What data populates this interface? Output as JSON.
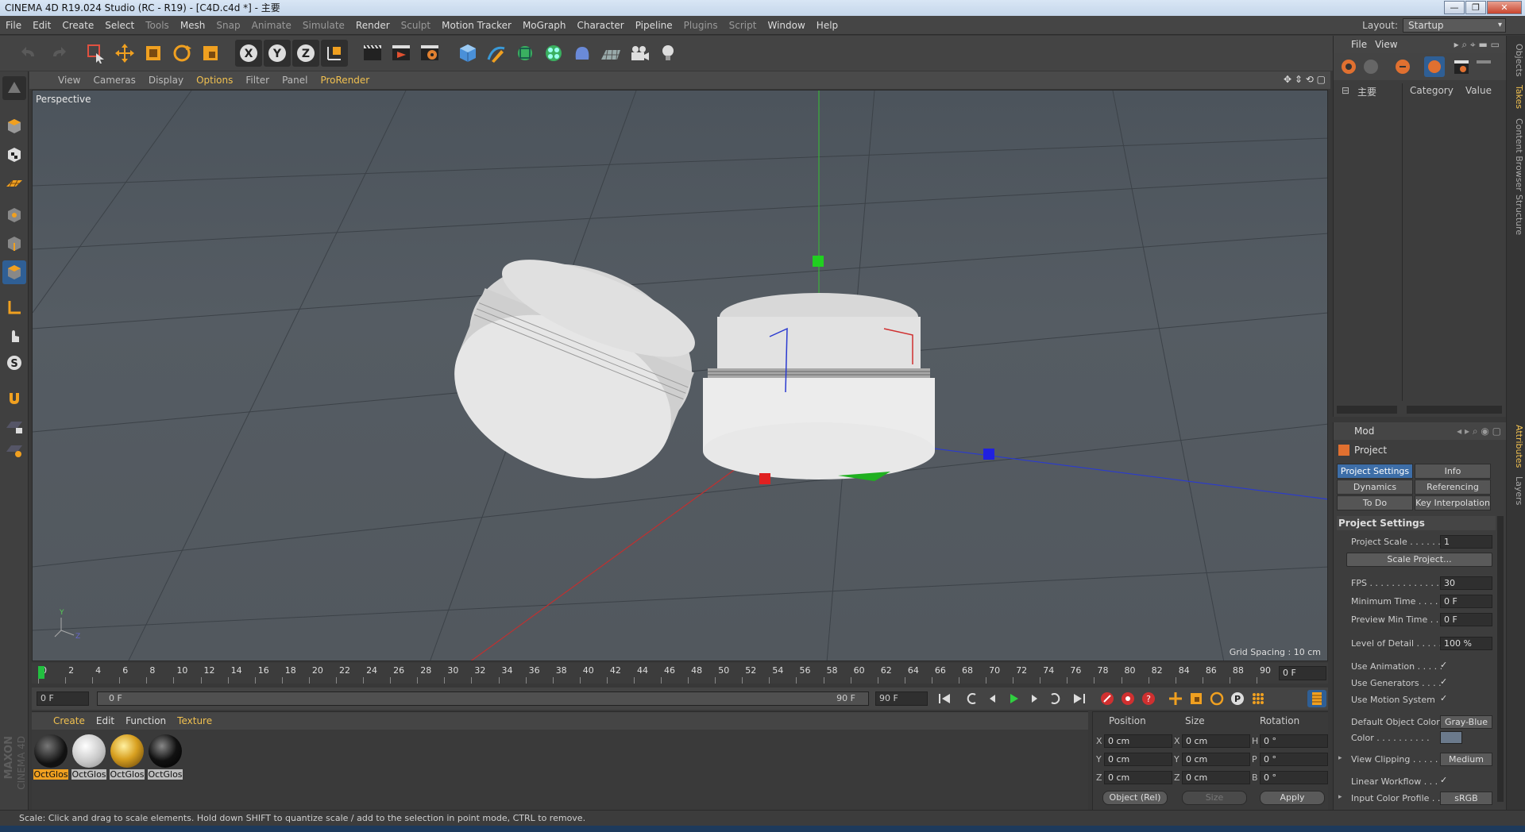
{
  "window": {
    "title": "CINEMA 4D R19.024 Studio (RC - R19) - [C4D.c4d *] - 主要"
  },
  "menubar": {
    "items": [
      "File",
      "Edit",
      "Create",
      "Select",
      "Tools",
      "Mesh",
      "Snap",
      "Animate",
      "Simulate",
      "Render",
      "Sculpt",
      "Motion Tracker",
      "MoGraph",
      "Character",
      "Pipeline",
      "Plugins",
      "Script",
      "Window",
      "Help"
    ],
    "layout_label": "Layout:",
    "layout_value": "Startup"
  },
  "viewport": {
    "menu": [
      "View",
      "Cameras",
      "Display",
      "Options",
      "Filter",
      "Panel",
      "ProRender"
    ],
    "active_menu": "Options",
    "label": "Perspective",
    "grid_spacing": "Grid Spacing : 10 cm"
  },
  "timeline": {
    "ticks": [
      "0",
      "2",
      "4",
      "6",
      "8",
      "10",
      "12",
      "14",
      "16",
      "18",
      "20",
      "22",
      "24",
      "26",
      "28",
      "30",
      "32",
      "34",
      "36",
      "38",
      "40",
      "42",
      "44",
      "46",
      "48",
      "50",
      "52",
      "54",
      "56",
      "58",
      "60",
      "62",
      "64",
      "66",
      "68",
      "70",
      "72",
      "74",
      "76",
      "78",
      "80",
      "82",
      "84",
      "86",
      "88",
      "90"
    ],
    "current_frame": "0 F",
    "start": "0 F",
    "range_start": "0 F",
    "range_end": "90 F",
    "end": "90 F"
  },
  "materials": {
    "menu": [
      "Create",
      "Edit",
      "Function",
      "Texture"
    ],
    "active_menu": "Texture",
    "items": [
      "OctGlos",
      "OctGlos",
      "OctGlos",
      "OctGlos"
    ]
  },
  "coords": {
    "headers": [
      "Position",
      "Size",
      "Rotation"
    ],
    "rows": [
      {
        "a": "X",
        "pos": "0 cm",
        "b": "X",
        "size": "0 cm",
        "c": "H",
        "rot": "0 °"
      },
      {
        "a": "Y",
        "pos": "0 cm",
        "b": "Y",
        "size": "0 cm",
        "c": "P",
        "rot": "0 °"
      },
      {
        "a": "Z",
        "pos": "0 cm",
        "b": "Z",
        "size": "0 cm",
        "c": "B",
        "rot": "0 °"
      }
    ],
    "mode": "Object (Rel)",
    "size_mode": "Size",
    "apply": "Apply"
  },
  "status": "Scale: Click and drag to scale elements. Hold down SHIFT to quantize scale / add to the selection in point mode, CTRL to remove.",
  "objects": {
    "menu": [
      "File",
      "View"
    ],
    "tree_item": "主要",
    "columns": [
      "Category",
      "Value"
    ]
  },
  "attributes": {
    "menu": "Mod",
    "title": "Project",
    "tabs": [
      "Project Settings",
      "Info",
      "Dynamics",
      "Referencing",
      "To Do",
      "Key Interpolation"
    ],
    "section": "Project Settings",
    "project_scale_label": "Project Scale . . . . . .",
    "project_scale": "1",
    "scale_project": "Scale Project...",
    "fps_label": "FPS . . . . . . . . . . . . .",
    "fps": "30",
    "min_time_label": "Minimum Time . . . . .",
    "min_time": "0 F",
    "preview_min_label": "Preview Min Time . . .",
    "preview_min": "0 F",
    "lod_label": "Level of Detail . . . . .",
    "lod": "100 %",
    "use_animation": "Use Animation . . . . .",
    "use_generators": "Use Generators . . . .",
    "use_motion": "Use Motion System",
    "check": "✓",
    "default_color_label": "Default Object Color",
    "default_color": "Gray-Blue",
    "color_label": "Color . . . . . . . . . .",
    "view_clipping_label": "View Clipping . . . . .",
    "view_clipping": "Medium",
    "linear_workflow": "Linear Workflow . . .",
    "input_profile_label": "Input Color Profile . .",
    "input_profile": "sRGB"
  },
  "sidetabs": [
    "Objects",
    "Takes",
    "Content Browser",
    "Structure",
    "Attributes",
    "Layers"
  ],
  "brand": {
    "top": "MAXON",
    "bottom": "CINEMA 4D"
  }
}
